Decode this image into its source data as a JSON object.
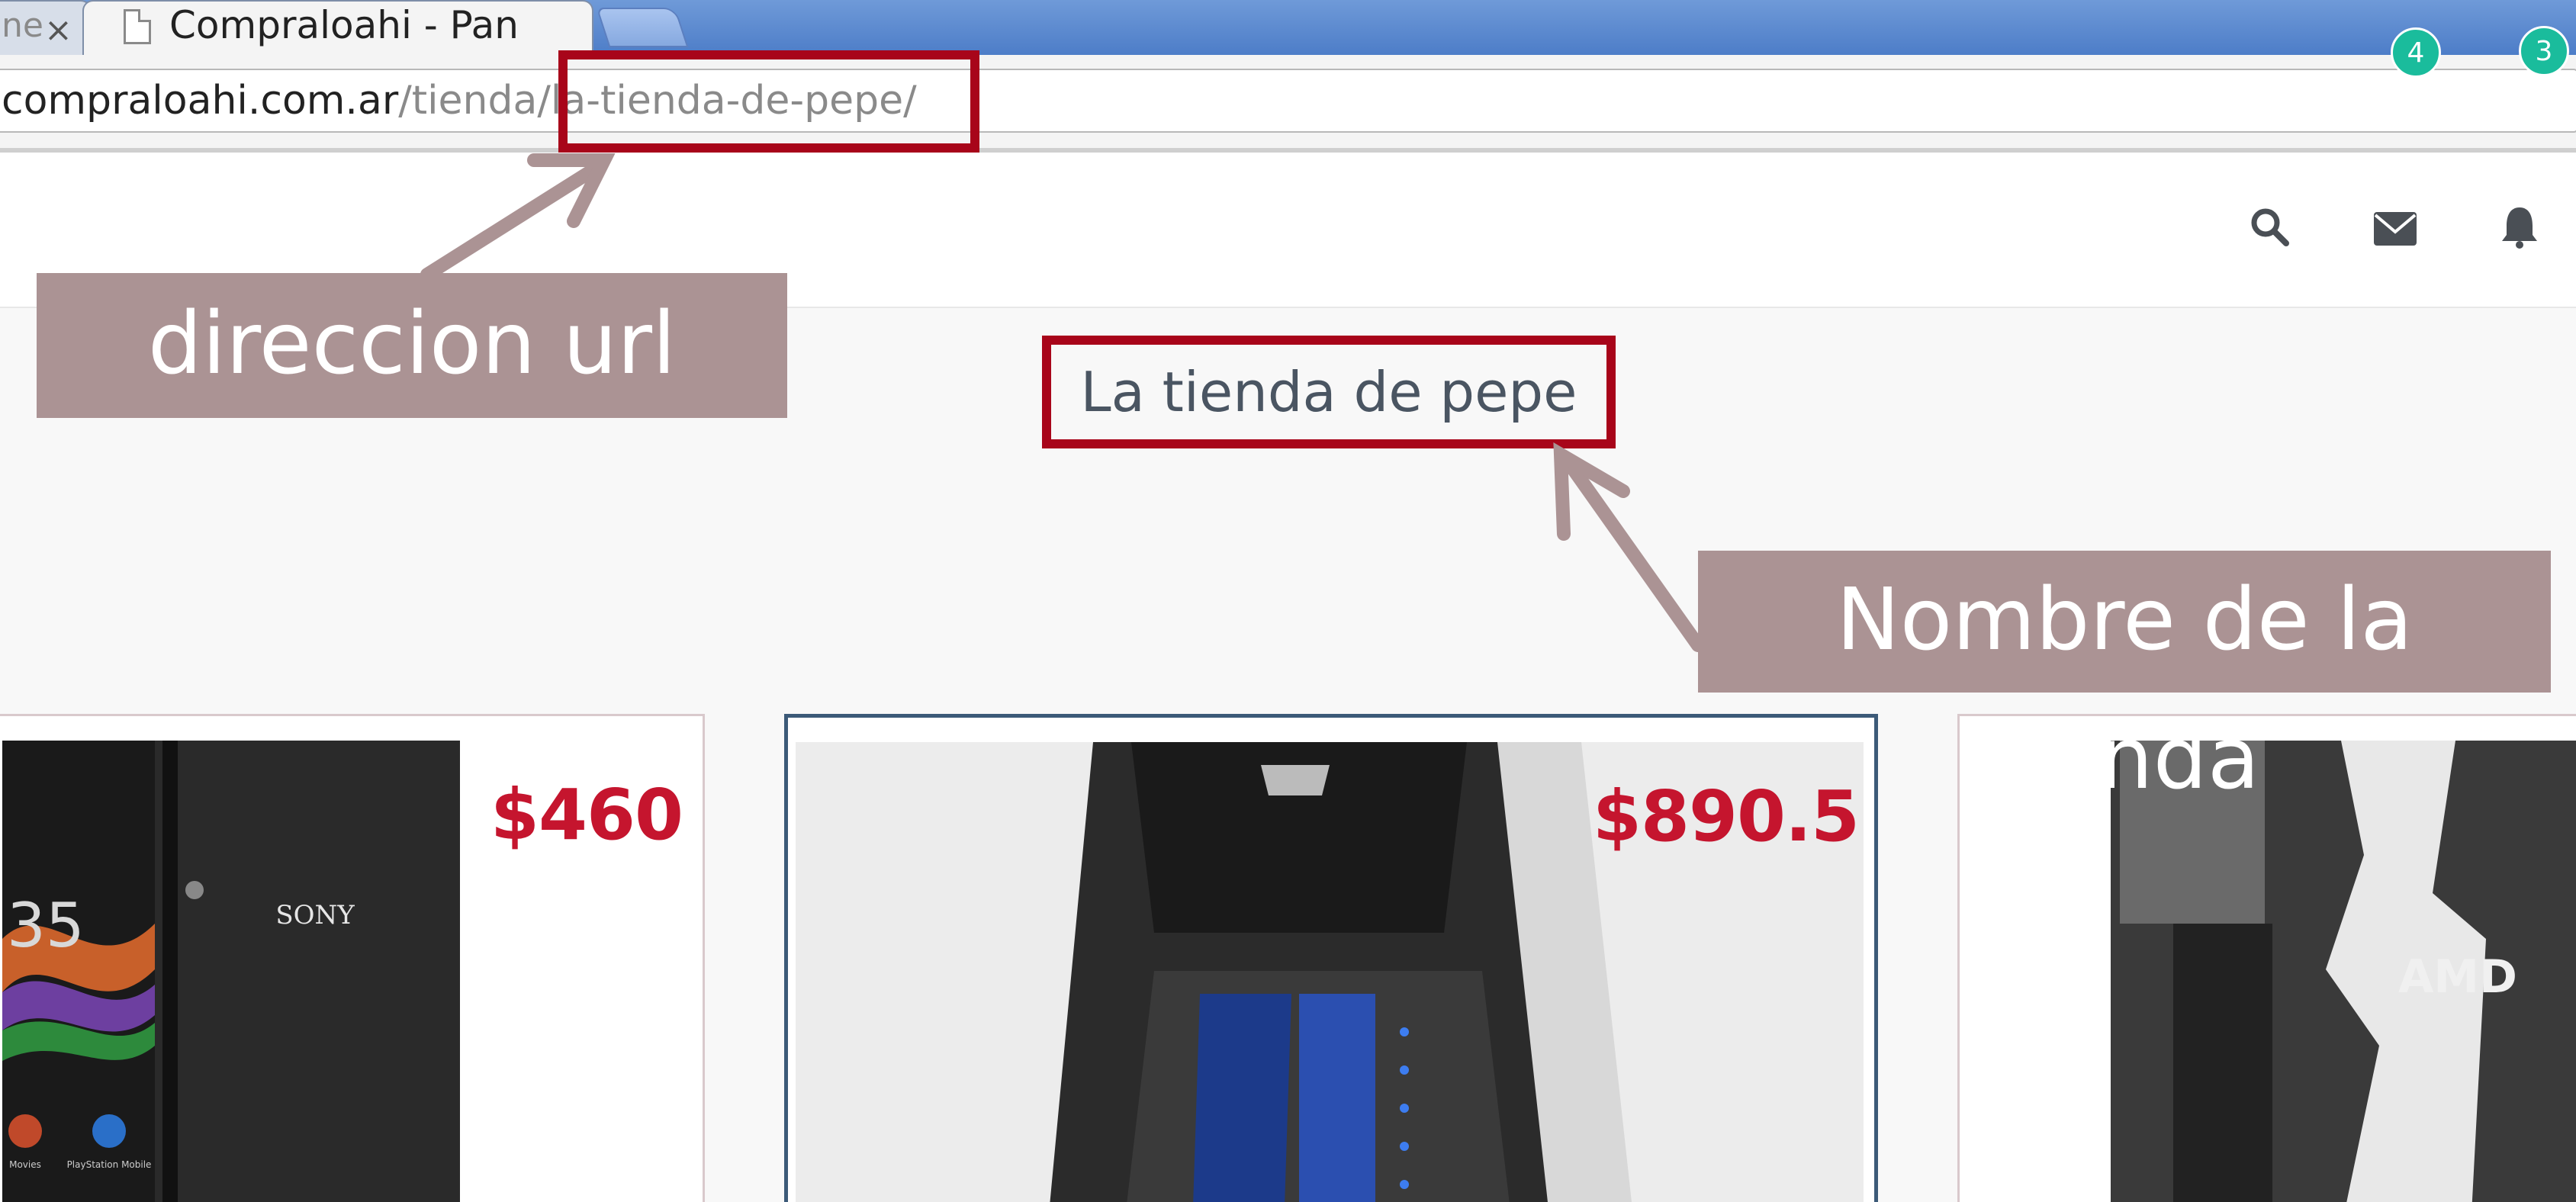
{
  "browser": {
    "prev_tab_title": "ne",
    "active_tab_title": "Compraloahi - Pane",
    "close_glyph": "×",
    "url_host": "compraloahi.com.ar",
    "url_path_1": "/tienda",
    "url_path_2": "/la-tienda-de-pepe/"
  },
  "header": {
    "mail_count": "4",
    "notifications_count": "3",
    "icons": [
      "search-icon",
      "mail-icon",
      "bell-icon"
    ]
  },
  "store": {
    "title": "La tienda de pepe"
  },
  "products": [
    {
      "price": "$460",
      "image_brand": "SONY",
      "phone_app_labels": [
        "Movies",
        "PlayStation Mobile"
      ]
    },
    {
      "price": "$890.5"
    },
    {
      "image_brand": "AMD"
    }
  ],
  "annotations": {
    "url_label": "direccion url",
    "store_label": "Nombre de la tienda"
  },
  "colors": {
    "highlight": "#a8051a",
    "label_bg": "#ab9394",
    "price": "#c5152e",
    "badge": "#1abc9c",
    "tabbar": "#4d7dc8"
  }
}
